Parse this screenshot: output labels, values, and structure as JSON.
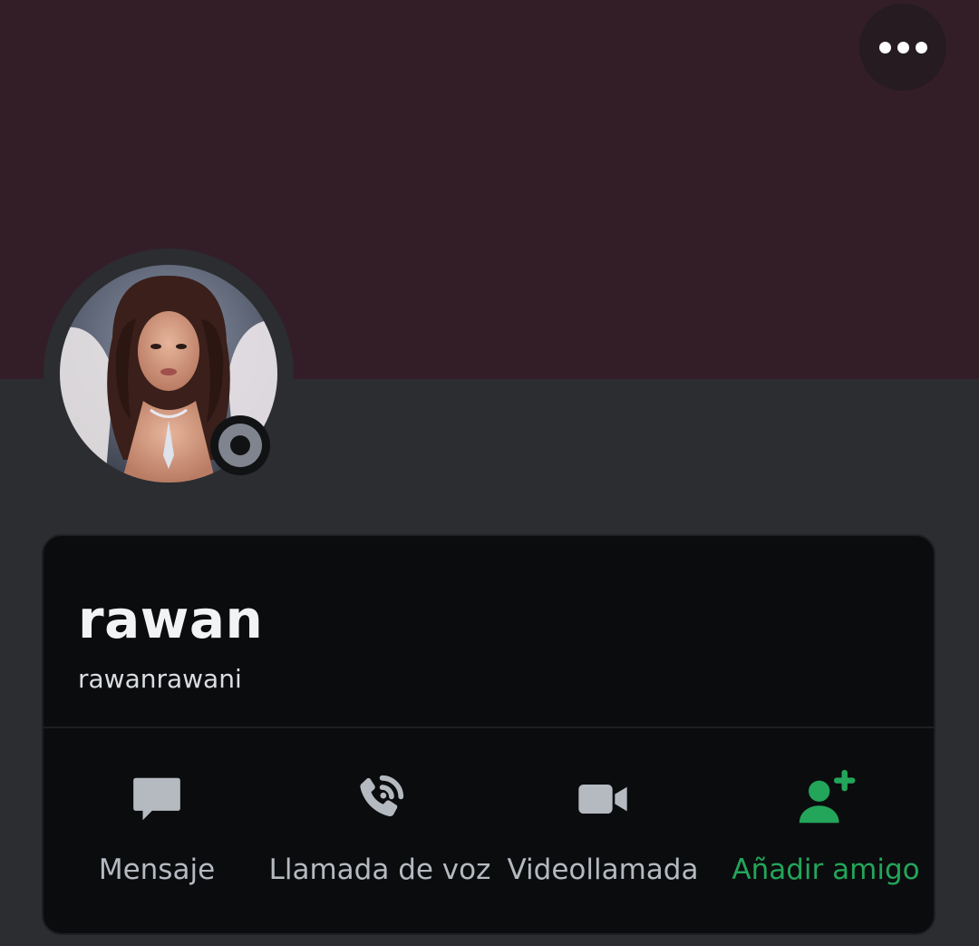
{
  "profile": {
    "display_name": "rawan",
    "username": "rawanrawani",
    "avatar_alt": "Profile photo",
    "status": "offline"
  },
  "banner": {
    "color": "#331e27"
  },
  "header": {
    "more_icon": "more-horizontal-icon"
  },
  "actions": [
    {
      "label": "Mensaje",
      "icon": "chat-bubble-icon"
    },
    {
      "label": "Llamada de voz",
      "icon": "phone-call-icon"
    },
    {
      "label": "Videollamada",
      "icon": "video-camera-icon"
    },
    {
      "label": "Añadir amigo",
      "icon": "add-friend-icon"
    }
  ],
  "colors": {
    "background": "#2b2d31",
    "card": "#0b0c0e",
    "icon_gray": "#b5bac1",
    "accent_green": "#23a55a",
    "status_offline": "#80848e"
  }
}
